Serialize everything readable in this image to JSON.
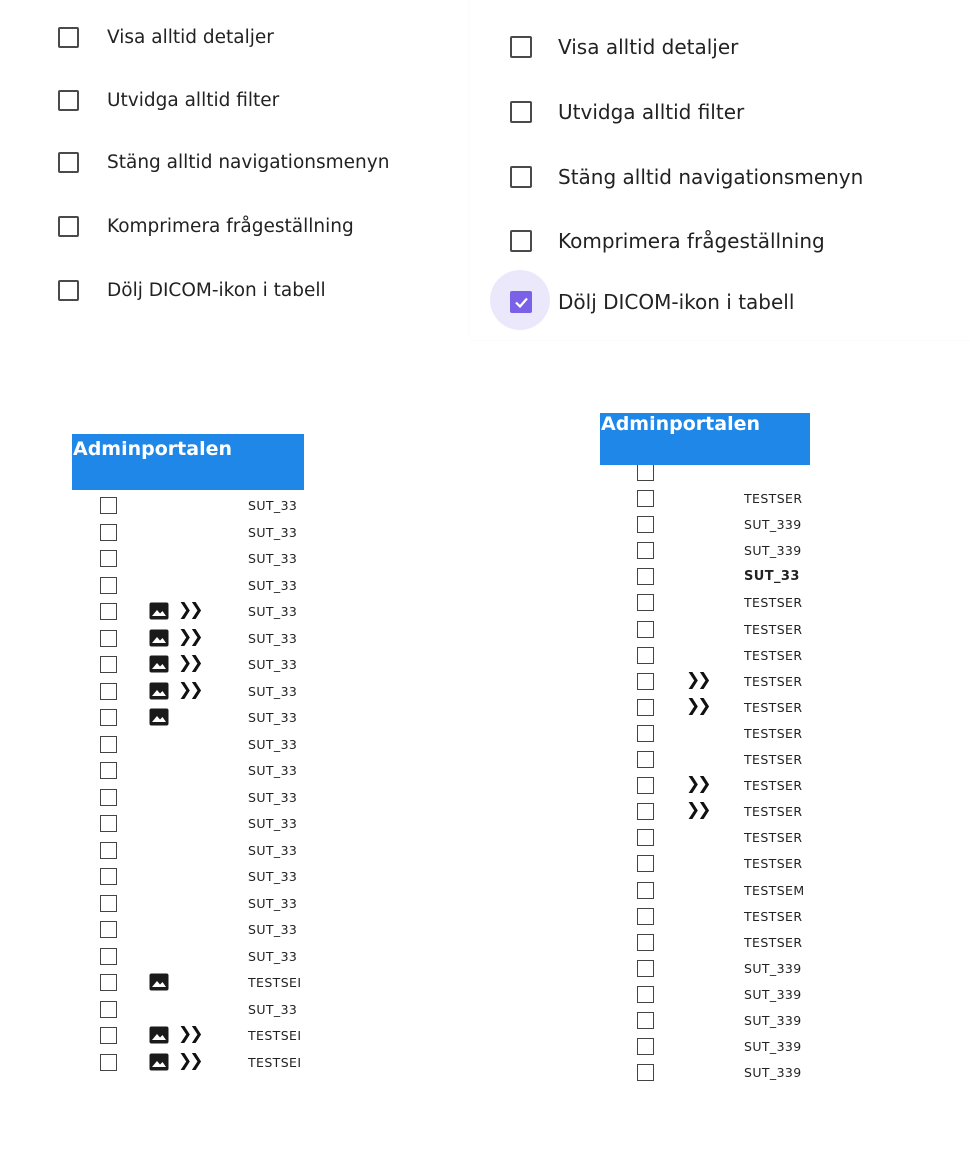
{
  "settings_before": {
    "options": [
      {
        "label": "Visa alltid detaljer",
        "checked": false
      },
      {
        "label": "Utvidga alltid filter",
        "checked": false
      },
      {
        "label": "Stäng alltid navigationsmenyn",
        "checked": false
      },
      {
        "label": "Komprimera frågeställning",
        "checked": false
      },
      {
        "label": "Dölj DICOM-ikon i tabell",
        "checked": false
      }
    ]
  },
  "settings_after": {
    "options": [
      {
        "label": "Visa alltid detaljer",
        "checked": false
      },
      {
        "label": "Utvidga alltid filter",
        "checked": false
      },
      {
        "label": "Stäng alltid navigationsmenyn",
        "checked": false
      },
      {
        "label": "Komprimera frågeställning",
        "checked": false
      },
      {
        "label": "Dölj DICOM-ikon i tabell",
        "checked": true
      }
    ],
    "accent_color": "#7b61e8"
  },
  "table_before": {
    "header": "Adminportalen",
    "header_color": "#1f87e8",
    "rows": [
      {
        "image_icon": false,
        "chevron": false,
        "text": "SUT_33"
      },
      {
        "image_icon": false,
        "chevron": false,
        "text": "SUT_33"
      },
      {
        "image_icon": false,
        "chevron": false,
        "text": "SUT_33"
      },
      {
        "image_icon": false,
        "chevron": false,
        "text": "SUT_33"
      },
      {
        "image_icon": true,
        "chevron": true,
        "text": "SUT_33"
      },
      {
        "image_icon": true,
        "chevron": true,
        "text": "SUT_33"
      },
      {
        "image_icon": true,
        "chevron": true,
        "text": "SUT_33"
      },
      {
        "image_icon": true,
        "chevron": true,
        "text": "SUT_33"
      },
      {
        "image_icon": true,
        "chevron": false,
        "text": "SUT_33"
      },
      {
        "image_icon": false,
        "chevron": false,
        "text": "SUT_33"
      },
      {
        "image_icon": false,
        "chevron": false,
        "text": "SUT_33"
      },
      {
        "image_icon": false,
        "chevron": false,
        "text": "SUT_33"
      },
      {
        "image_icon": false,
        "chevron": false,
        "text": "SUT_33"
      },
      {
        "image_icon": false,
        "chevron": false,
        "text": "SUT_33"
      },
      {
        "image_icon": false,
        "chevron": false,
        "text": "SUT_33"
      },
      {
        "image_icon": false,
        "chevron": false,
        "text": "SUT_33"
      },
      {
        "image_icon": false,
        "chevron": false,
        "text": "SUT_33"
      },
      {
        "image_icon": false,
        "chevron": false,
        "text": "SUT_33"
      },
      {
        "image_icon": true,
        "chevron": false,
        "text": "TESTSEI"
      },
      {
        "image_icon": false,
        "chevron": false,
        "text": "SUT_33"
      },
      {
        "image_icon": true,
        "chevron": true,
        "text": "TESTSEI"
      },
      {
        "image_icon": true,
        "chevron": true,
        "text": "TESTSEI"
      }
    ]
  },
  "table_after": {
    "header": "Adminportalen",
    "rows": [
      {
        "chevron": false,
        "text": "TESTSER",
        "bold": false
      },
      {
        "chevron": false,
        "text": "SUT_339",
        "bold": false
      },
      {
        "chevron": false,
        "text": "SUT_339",
        "bold": false
      },
      {
        "chevron": false,
        "text": "SUT_33",
        "bold": true
      },
      {
        "chevron": false,
        "text": "TESTSER",
        "bold": false
      },
      {
        "chevron": false,
        "text": "TESTSER",
        "bold": false
      },
      {
        "chevron": false,
        "text": "TESTSER",
        "bold": false
      },
      {
        "chevron": true,
        "text": "TESTSER",
        "bold": false
      },
      {
        "chevron": true,
        "text": "TESTSER",
        "bold": false
      },
      {
        "chevron": false,
        "text": "TESTSER",
        "bold": false
      },
      {
        "chevron": false,
        "text": "TESTSER",
        "bold": false
      },
      {
        "chevron": true,
        "text": "TESTSER",
        "bold": false
      },
      {
        "chevron": true,
        "text": "TESTSER",
        "bold": false
      },
      {
        "chevron": false,
        "text": "TESTSER",
        "bold": false
      },
      {
        "chevron": false,
        "text": "TESTSER",
        "bold": false
      },
      {
        "chevron": false,
        "text": "TESTSEM",
        "bold": false
      },
      {
        "chevron": false,
        "text": "TESTSER",
        "bold": false
      },
      {
        "chevron": false,
        "text": "TESTSER",
        "bold": false
      },
      {
        "chevron": false,
        "text": "SUT_339",
        "bold": false
      },
      {
        "chevron": false,
        "text": "SUT_339",
        "bold": false
      },
      {
        "chevron": false,
        "text": "SUT_339",
        "bold": false
      },
      {
        "chevron": false,
        "text": "SUT_339",
        "bold": false
      },
      {
        "chevron": false,
        "text": "SUT_339",
        "bold": false
      }
    ]
  }
}
